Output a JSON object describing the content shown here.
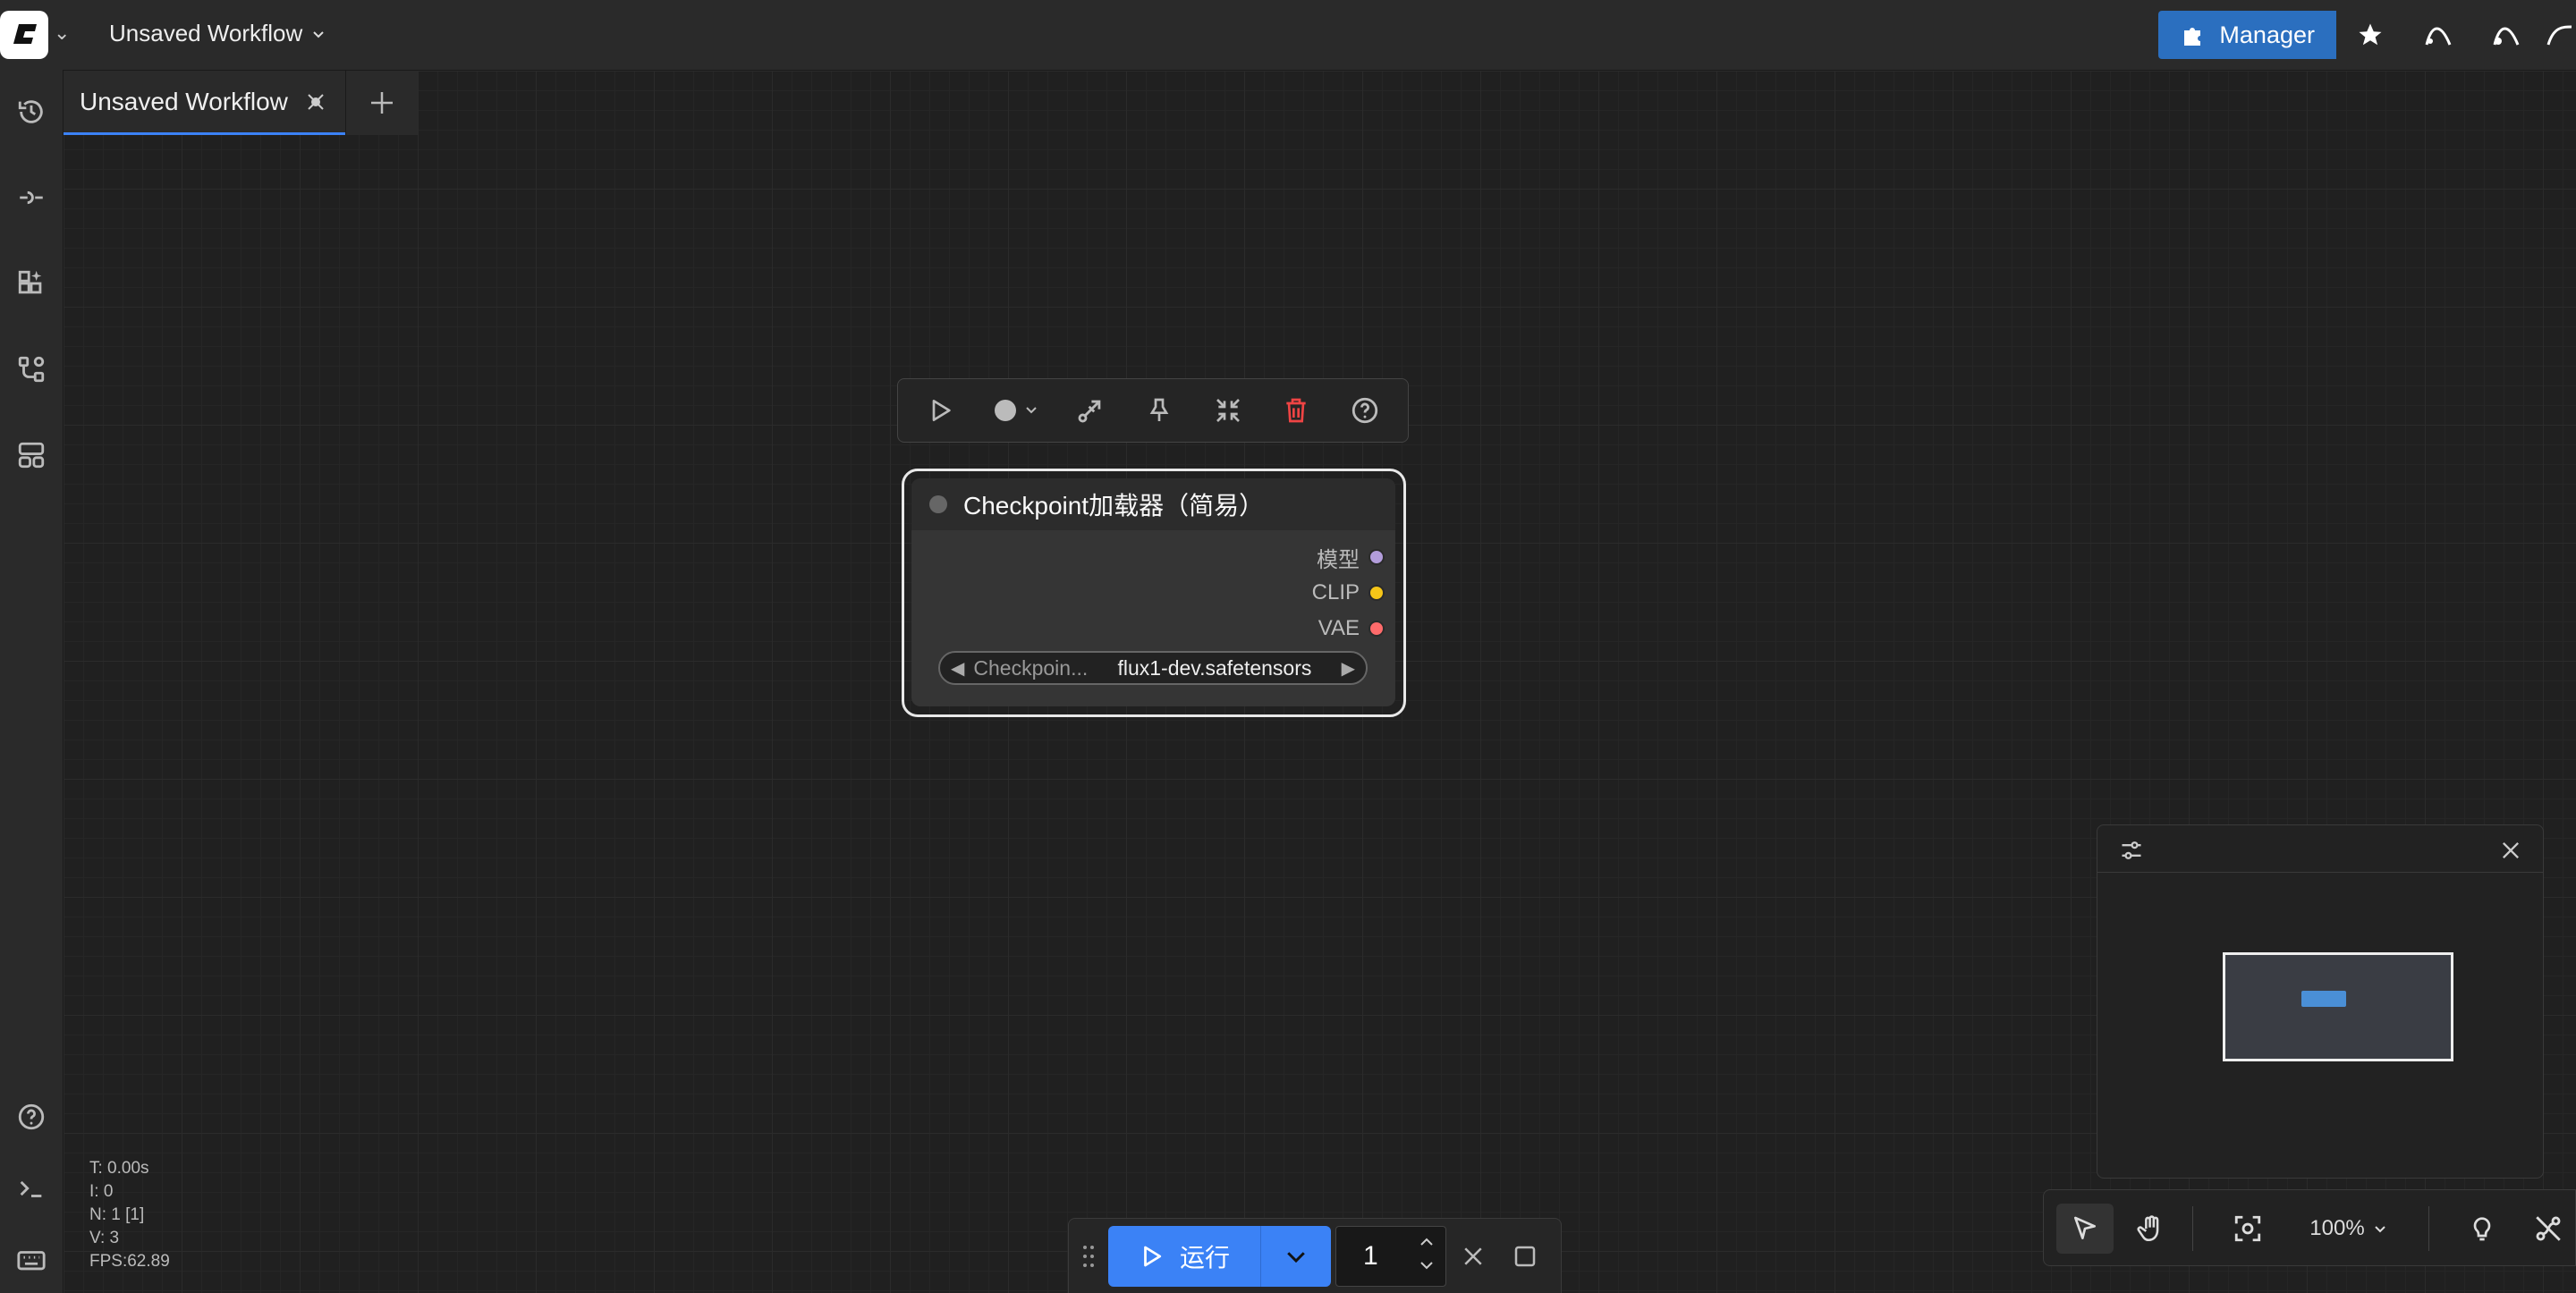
{
  "app": {
    "workflow_title": "Unsaved Workflow",
    "manager_label": "Manager"
  },
  "tabs": [
    {
      "label": "Unsaved Workflow"
    }
  ],
  "node": {
    "title": "Checkpoint加载器（简易）",
    "outputs": [
      {
        "label": "模型",
        "color": "#b39ddb"
      },
      {
        "label": "CLIP",
        "color": "#f5c518"
      },
      {
        "label": "VAE",
        "color": "#ff6b6b"
      }
    ],
    "widget": {
      "name": "Checkpoin...",
      "value": "flux1-dev.safetensors"
    }
  },
  "stats": {
    "t": "T: 0.00s",
    "i": "I: 0",
    "n": "N: 1 [1]",
    "v": "V: 3",
    "fps": "FPS:62.89"
  },
  "runbar": {
    "run_label": "运行",
    "count": "1"
  },
  "canvas_controls": {
    "zoom": "100%"
  },
  "colors": {
    "accent": "#3b82f6",
    "manager": "#2b6fbf",
    "delete": "#ef4444"
  }
}
